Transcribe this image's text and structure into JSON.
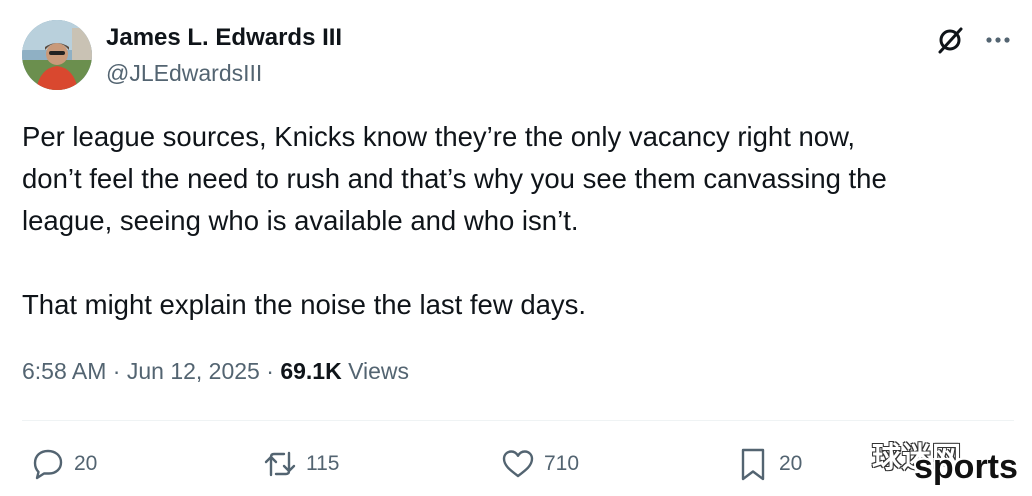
{
  "author": {
    "display_name": "James L. Edwards III",
    "handle": "@JLEdwardsIII"
  },
  "tweet": {
    "lines": [
      "Per league sources, Knicks know they’re the only vacancy right now,",
      "don’t feel the need to rush and that’s why you see them canvassing the",
      "league, seeing who is available and who isn’t.",
      "That might explain the noise the last few days."
    ],
    "time": "6:58 AM",
    "separator": "·",
    "date": "Jun 12, 2025",
    "views_count": "69.1K",
    "views_label": "Views"
  },
  "actions": {
    "replies": "20",
    "reposts": "115",
    "likes": "710",
    "bookmarks": "20"
  },
  "watermark": {
    "chinese": "球迷网",
    "english": "sports"
  },
  "icons": [
    "grok-icon",
    "more-icon",
    "reply-icon",
    "repost-icon",
    "like-icon",
    "bookmark-icon"
  ],
  "colors": {
    "text": "#0f1419",
    "secondary": "#536471",
    "divider": "#eff3f4"
  }
}
